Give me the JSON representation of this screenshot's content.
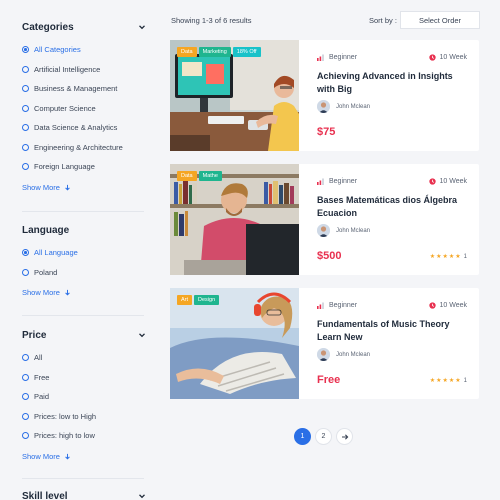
{
  "filters": {
    "categories": {
      "title": "Categories",
      "items": [
        {
          "label": "All Categories",
          "selected": true
        },
        {
          "label": "Artificial Intelligence",
          "selected": false
        },
        {
          "label": "Business & Management",
          "selected": false
        },
        {
          "label": "Computer Science",
          "selected": false
        },
        {
          "label": "Data Science & Analytics",
          "selected": false
        },
        {
          "label": "Engineering & Architecture",
          "selected": false
        },
        {
          "label": "Foreign Language",
          "selected": false
        }
      ],
      "show_more": "Show More"
    },
    "language": {
      "title": "Language",
      "items": [
        {
          "label": "All Language",
          "selected": true
        },
        {
          "label": "Poland",
          "selected": false
        }
      ],
      "show_more": "Show More"
    },
    "price": {
      "title": "Price",
      "items": [
        {
          "label": "All",
          "selected": false
        },
        {
          "label": "Free",
          "selected": false
        },
        {
          "label": "Paid",
          "selected": false
        },
        {
          "label": "Prices: low to High",
          "selected": false
        },
        {
          "label": "Prices: high to low",
          "selected": false
        }
      ],
      "show_more": "Show More"
    },
    "skill": {
      "title": "Skill level"
    }
  },
  "toolbar": {
    "result_count": "Showing 1-3 of 6 results",
    "sort_label": "Sort by :",
    "sort_value": "Select Order"
  },
  "courses": [
    {
      "tags": [
        {
          "label": "Data",
          "color": "#f5a623"
        },
        {
          "label": "Marketing",
          "color": "#1fb58f"
        },
        {
          "label": "18% Off",
          "color": "#19c2c9"
        }
      ],
      "level": "Beginner",
      "duration": "10 Week",
      "title": "Achieving Advanced in Insights with Big",
      "author": "John Mclean",
      "price": "$75",
      "rating": ""
    },
    {
      "tags": [
        {
          "label": "Data",
          "color": "#f5a623"
        },
        {
          "label": "Mathe",
          "color": "#1fb58f"
        }
      ],
      "level": "Beginner",
      "duration": "10 Week",
      "title": "Bases Matemáticas dios Álgebra Ecuacion",
      "author": "John Mclean",
      "price": "$500",
      "rating": "1"
    },
    {
      "tags": [
        {
          "label": "Art",
          "color": "#f5a623"
        },
        {
          "label": "Design",
          "color": "#1fb58f"
        }
      ],
      "level": "Beginner",
      "duration": "10 Week",
      "title": "Fundamentals of Music Theory Learn New",
      "author": "John Mclean",
      "price": "Free",
      "rating": "1"
    }
  ],
  "pagination": {
    "pages": [
      "1",
      "2"
    ],
    "current": "1",
    "next_icon": "arrow-right-icon"
  },
  "colors": {
    "accent": "#2a6fe6",
    "price": "#e8304f",
    "star": "#f5a623"
  }
}
